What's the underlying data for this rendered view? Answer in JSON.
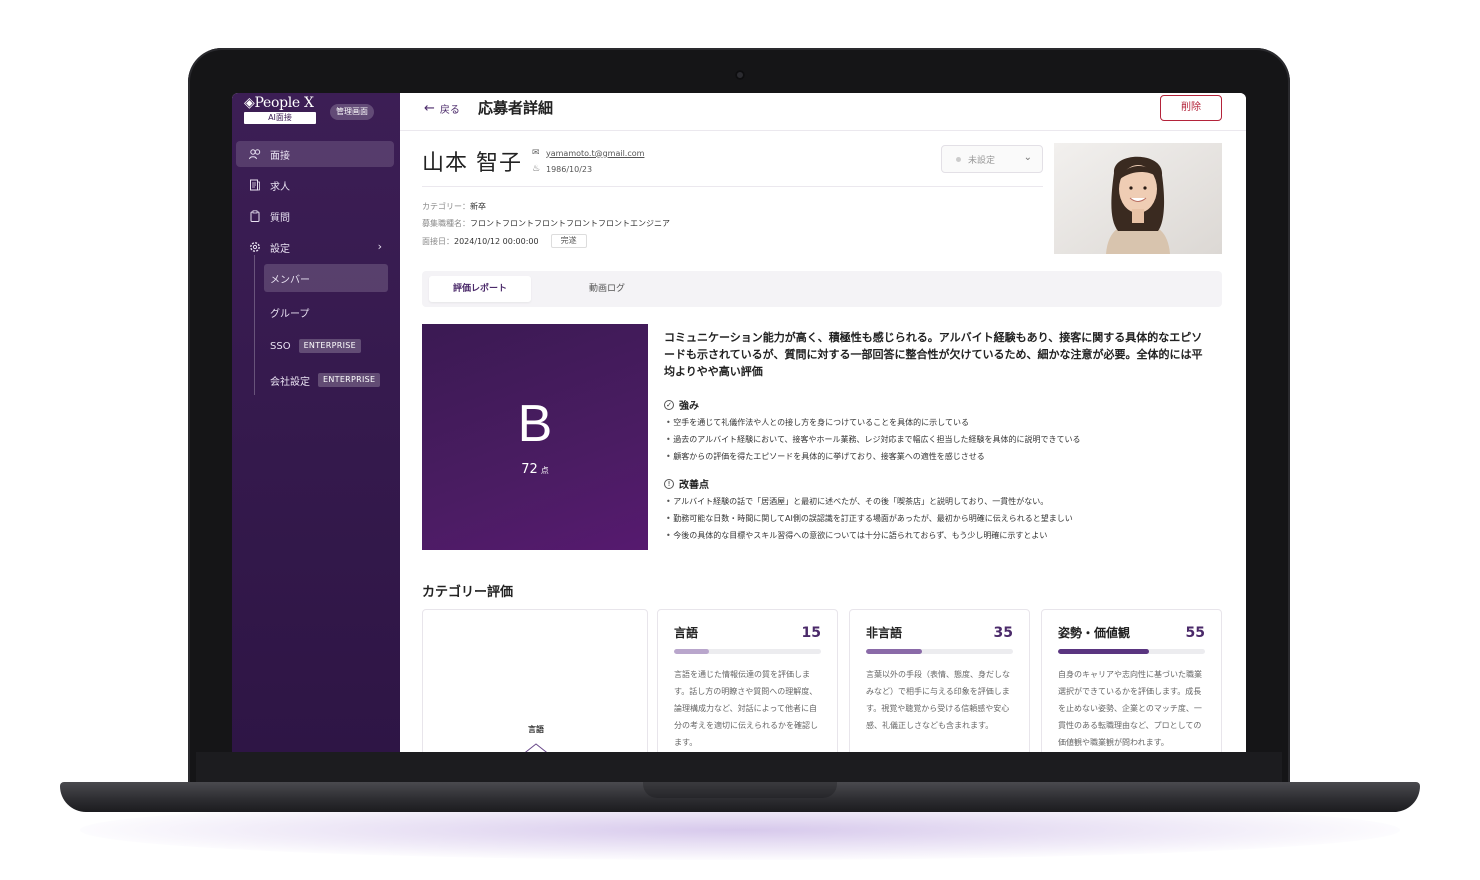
{
  "sidebar": {
    "logo": "People X",
    "logo_sub": "AI面接",
    "admin_badge": "管理画面",
    "nav": [
      {
        "label": "面接",
        "icon": "users-icon"
      },
      {
        "label": "求人",
        "icon": "document-icon"
      },
      {
        "label": "質問",
        "icon": "clipboard-icon"
      },
      {
        "label": "設定",
        "icon": "gear-icon"
      }
    ],
    "sub": [
      {
        "label": "メンバー"
      },
      {
        "label": "グループ"
      },
      {
        "label": "SSO",
        "badge": "ENTERPRISE"
      },
      {
        "label": "会社設定",
        "badge": "ENTERPRISE"
      }
    ]
  },
  "header": {
    "back": "戻る",
    "title": "応募者詳細",
    "delete": "削除"
  },
  "applicant": {
    "name": "山本 智子",
    "email": "yamamoto.t@gmail.com",
    "birthdate": "1986/10/23",
    "status": "未設定",
    "category_label": "カテゴリー：",
    "category": "新卒",
    "position_label": "募集職種名：",
    "position": "フロントフロントフロントフロントフロントエンジニア",
    "date_label": "面接日：",
    "date": "2024/10/12 00:00:00",
    "state": "完遂"
  },
  "tabs": [
    "評価レポート",
    "動画ログ"
  ],
  "grade": {
    "letter": "B",
    "score": "72",
    "unit": "点"
  },
  "summary": "コミュニケーション能力が高く、積極性も感じられる。アルバイト経験もあり、接客に関する具体的なエピソードも示されているが、質問に対する一部回答に整合性が欠けているため、細かな注意が必要。全体的には平均よりやや高い評価",
  "strengths": {
    "title": "強み",
    "items": [
      "空手を通じて礼儀作法や人との接し方を身につけていることを具体的に示している",
      "過去のアルバイト経験において、接客やホール業務、レジ対応まで幅広く担当した経験を具体的に説明できている",
      "顧客からの評価を得たエピソードを具体的に挙げており、接客業への適性を感じさせる"
    ]
  },
  "improvements": {
    "title": "改善点",
    "items": [
      "アルバイト経験の話で「居酒屋」と最初に述べたが、その後「喫茶店」と説明しており、一貫性がない。",
      "勤務可能な日数・時間に関してAI側の誤認識を訂正する場面があったが、最初から明確に伝えられると望ましい",
      "今後の具体的な目標やスキル習得への意欲については十分に語られておらず、もう少し明確に示すとよい"
    ]
  },
  "category_eval": {
    "title": "カテゴリー評価",
    "radar_label": "言語",
    "cards": [
      {
        "name": "言語",
        "score": "15",
        "percent": 24,
        "color": "#b9a6cc",
        "desc": "言語を通じた情報伝達の質を評価します。話し方の明瞭さや質問への理解度、論理構成力など、対話によって他者に自分の考えを適切に伝えられるかを確認します。"
      },
      {
        "name": "非言語",
        "score": "35",
        "percent": 38,
        "color": "#8a6aa8",
        "desc": "言葉以外の手段（表情、態度、身だしなみなど）で相手に与える印象を評価します。視覚や聴覚から受ける信頼感や安心感、礼儀正しさなども含まれます。"
      },
      {
        "name": "姿勢・価値観",
        "score": "55",
        "percent": 62,
        "color": "#5a3580",
        "desc": "自身のキャリアや志向性に基づいた職業選択ができているかを評価します。成長を止めない姿勢、企業とのマッチ度、一貫性のある転職理由など、プロとしての価値観や職業観が問われます。"
      }
    ]
  }
}
